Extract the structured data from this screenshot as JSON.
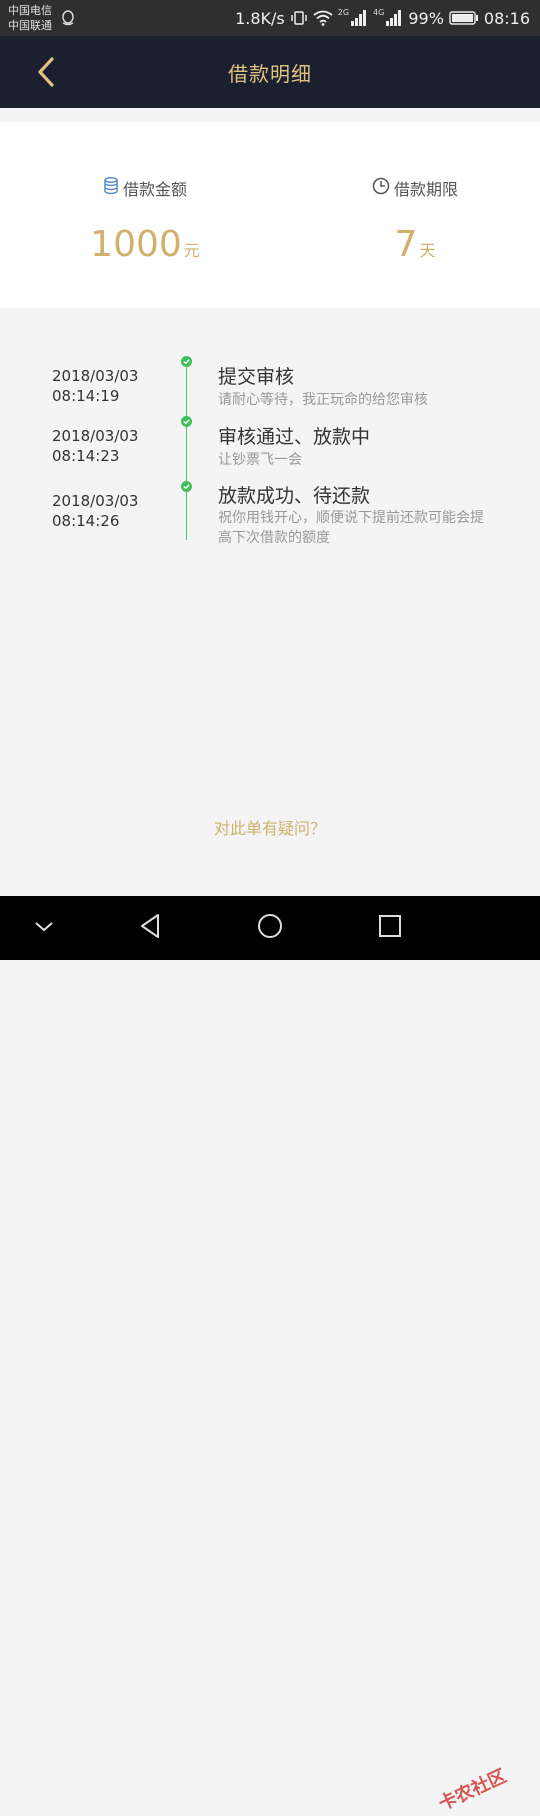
{
  "status_bar": {
    "carrier_1": "中国电信",
    "carrier_2": "中国联通",
    "speed": "1.8K/s",
    "net_1": "2G",
    "net_2": "4G",
    "battery": "99%",
    "time": "08:16",
    "icons": [
      "qq-icon",
      "vibrate-icon",
      "wifi-icon",
      "signal-icon",
      "signal-icon",
      "battery-icon"
    ]
  },
  "header": {
    "title": "借款明细",
    "back_icon": "chevron-left-icon",
    "accent_color": "#e2c27e",
    "background_color": "#1b2030"
  },
  "summary": {
    "amount_label": "借款金额",
    "amount_value": "1000",
    "amount_unit": "元",
    "amount_icon": "coin-stack-icon",
    "term_label": "借款期限",
    "term_value": "7",
    "term_unit": "天",
    "term_icon": "clock-icon",
    "value_color": "#d2b06c"
  },
  "timeline": {
    "line_color": "#4fc36a",
    "items": [
      {
        "date": "2018/03/03",
        "time": "08:14:19",
        "title": "提交审核",
        "desc": "请耐心等待，我正玩命的给您审核"
      },
      {
        "date": "2018/03/03",
        "time": "08:14:23",
        "title": "审核通过、放款中",
        "desc": "让钞票飞一会"
      },
      {
        "date": "2018/03/03",
        "time": "08:14:26",
        "title": "放款成功、待还款",
        "desc": "祝你用钱开心，顺便说下提前还款可能会提高下次借款的额度"
      }
    ]
  },
  "footer": {
    "question_link": "对此单有疑问？"
  },
  "android_nav": {
    "icons": [
      "chevron-down-icon",
      "back-triangle-icon",
      "home-circle-icon",
      "recents-square-icon"
    ]
  },
  "watermark": "卡农社区"
}
